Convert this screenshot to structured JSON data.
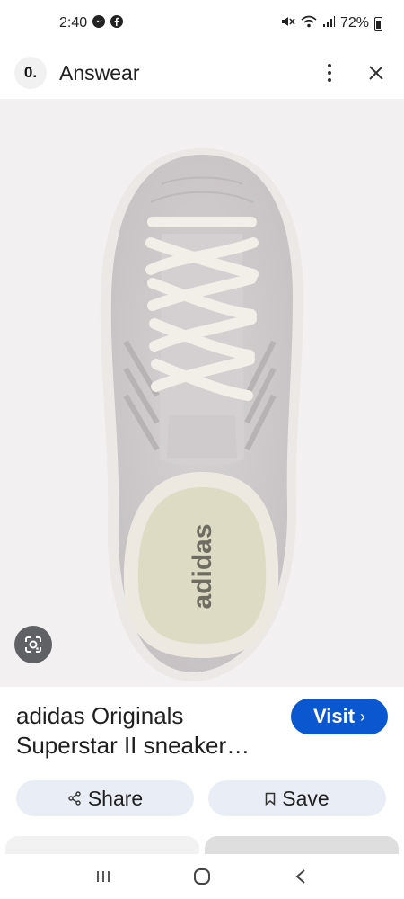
{
  "status_bar": {
    "time": "2:40",
    "battery": "72%",
    "icons": [
      "messenger-icon",
      "facebook-icon",
      "mute-icon",
      "wifi-icon",
      "signal-icon",
      "battery-icon"
    ]
  },
  "app_bar": {
    "logo_text": "0.",
    "title": "Answear",
    "icons": [
      "more-vert-icon",
      "close-icon"
    ]
  },
  "image": {
    "subject": "shoe",
    "insole_text": "adidas",
    "lens_icon": "google-lens-icon"
  },
  "product": {
    "title": "adidas Originals Superstar II sneaker…",
    "visit_label": "Visit",
    "visit_chevron": "›",
    "accent": "#0b57d0"
  },
  "actions": {
    "share_label": "Share",
    "save_label": "Save"
  },
  "nav": {
    "icons": [
      "recents-icon",
      "home-icon",
      "back-icon"
    ]
  }
}
